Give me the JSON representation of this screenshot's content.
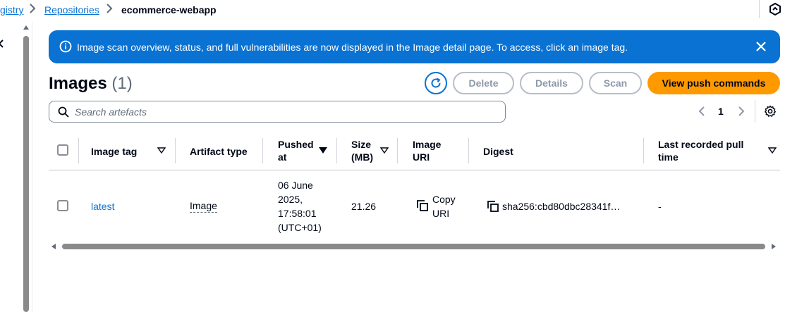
{
  "breadcrumb": {
    "items": [
      {
        "label": "gistry"
      },
      {
        "label": "Repositories"
      },
      {
        "label": "ecommerce-webapp"
      }
    ]
  },
  "flash": {
    "message": "Image scan overview, status, and full vulnerabilities are now displayed in the Image detail page. To access, click an image tag.",
    "color": "#0972d3"
  },
  "header": {
    "title": "Images",
    "count": "(1)"
  },
  "actions": {
    "delete": "Delete",
    "details": "Details",
    "scan": "Scan",
    "view_push_commands": "View push commands",
    "primary_color": "#ff9900"
  },
  "search": {
    "placeholder": "Search artefacts",
    "value": ""
  },
  "pagination": {
    "current_page": "1"
  },
  "table": {
    "columns": {
      "image_tag": "Image tag",
      "artifact_type": "Artifact type",
      "pushed_at_1": "Pushed",
      "pushed_at_2": "at",
      "size_1": "Size",
      "size_2": "(MB)",
      "uri_1": "Image",
      "uri_2": "URI",
      "digest": "Digest",
      "last_pull_1": "Last recorded pull",
      "last_pull_2": "time"
    },
    "rows": [
      {
        "image_tag": "latest",
        "artifact_type": "Image",
        "pushed_at": [
          "06 June",
          "2025,",
          "17:58:01",
          "(UTC+01)"
        ],
        "size": "21.26",
        "uri_copy": [
          "Copy",
          "URI"
        ],
        "digest": "sha256:cbd80dbc28341f…",
        "last_pull": "-"
      }
    ]
  },
  "icons": [
    "chevron-right-icon",
    "top-right-icon",
    "close-icon",
    "info-icon",
    "refresh-icon",
    "search-icon",
    "chevron-left-icon",
    "settings-icon",
    "sort-caret-icon",
    "copy-icon"
  ]
}
